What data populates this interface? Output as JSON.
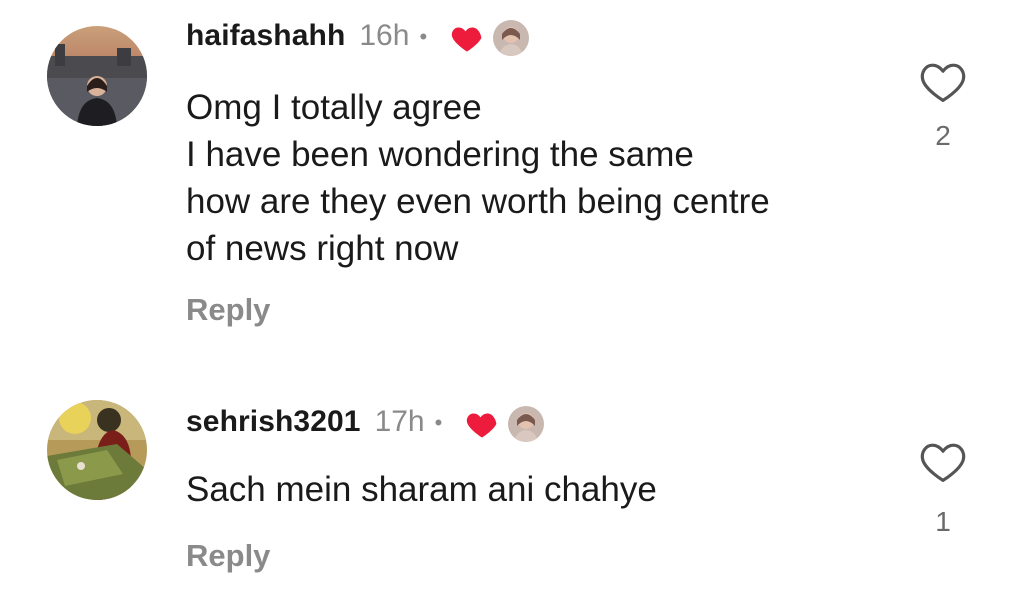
{
  "comments": [
    {
      "username": "haifashahh",
      "time": "16h",
      "dot": "•",
      "lines": [
        "Omg I totally agree",
        "I have been wondering the same",
        "how are they even worth being centre",
        "of news right now"
      ],
      "reply_label": "Reply",
      "like_count": "2",
      "icons": {
        "liked_by_author": "heart-icon",
        "like": "heart-outline-icon"
      }
    },
    {
      "username": "sehrish3201",
      "time": "17h",
      "dot": "•",
      "lines": [
        "Sach mein sharam ani chahye"
      ],
      "reply_label": "Reply",
      "like_count": "1",
      "icons": {
        "liked_by_author": "heart-icon",
        "like": "heart-outline-icon"
      }
    }
  ],
  "colors": {
    "heart_red": "#ed1c3c",
    "muted": "#8a8a8a"
  }
}
